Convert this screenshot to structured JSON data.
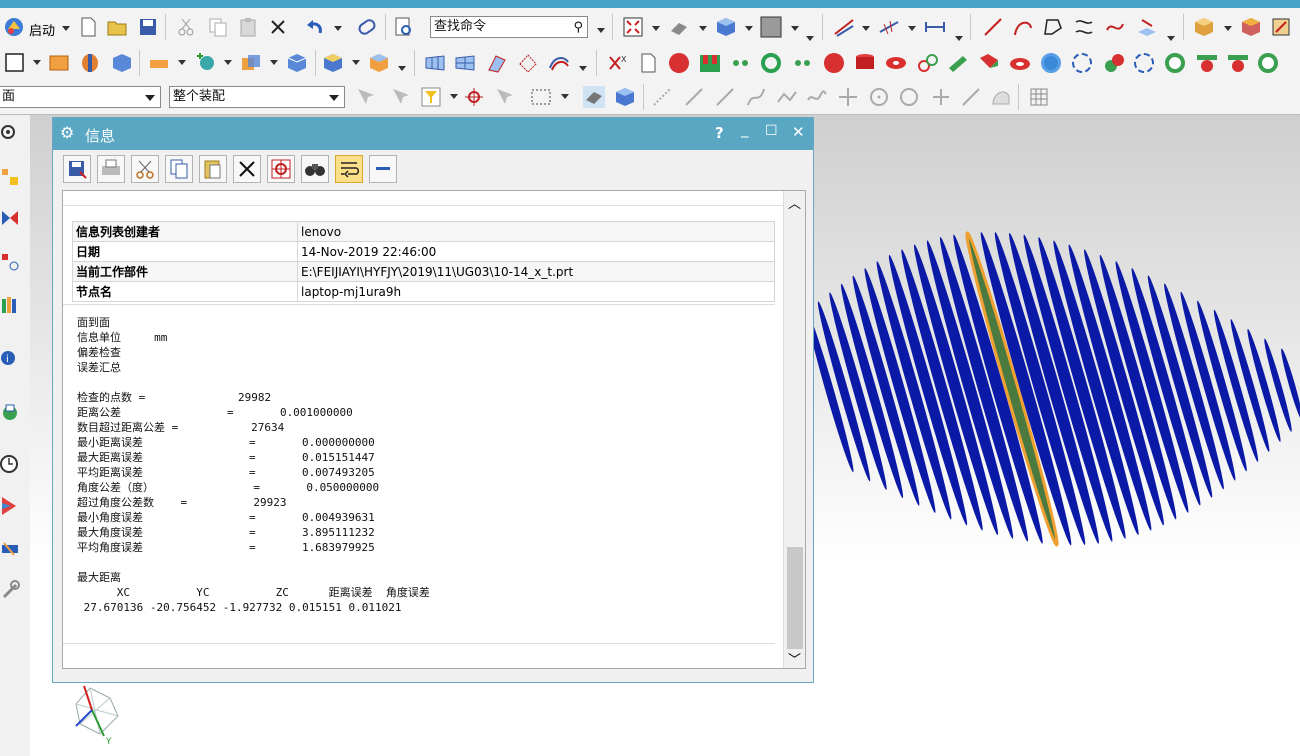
{
  "toolbar": {
    "start_label": "启动",
    "command_search_placeholder": "查找命令",
    "filter_select_value": "面",
    "assembly_select_value": "整个装配"
  },
  "dialog": {
    "title": "信息",
    "help_label": "?",
    "minimize_label": "_",
    "maximize_label": "☐",
    "close_label": "✕",
    "info_table": [
      {
        "label": "信息列表创建者",
        "value": "lenovo"
      },
      {
        "label": "日期",
        "value": "14-Nov-2019 22:46:00"
      },
      {
        "label": "当前工作部件",
        "value": "E:\\FEIJIAYI\\HYFJY\\2019\\11\\UG03\\10-14_x_t.prt"
      },
      {
        "label": "节点名",
        "value": "laptop-mj1ura9h"
      }
    ],
    "report_text": "面到面\n信息单位     mm\n偏差检查\n误差汇总\n\n检查的点数 =              29982\n距离公差                =       0.001000000\n数目超过距离公差 =           27634\n最小距离误差                =       0.000000000\n最大距离误差                =       0.015151447\n平均距离误差                =       0.007493205\n角度公差（度）               =       0.050000000\n超过角度公差数    =          29923\n最小角度误差                =       0.004939631\n最大角度误差                =       3.895111232\n平均角度误差                =       1.683979925\n\n最大距离\n      XC          YC          ZC      距离误差  角度误差\n 27.670136 -20.756452 -1.927732 0.015151 0.011021"
  },
  "axes": {
    "x": "X",
    "y": "Y",
    "z": "Z"
  },
  "colors": {
    "title_bar": "#5aa7c4",
    "fin_blue": "#0b1aa6",
    "fin_highlight": "#4a7a3f",
    "fin_outline": "#f0a030"
  }
}
